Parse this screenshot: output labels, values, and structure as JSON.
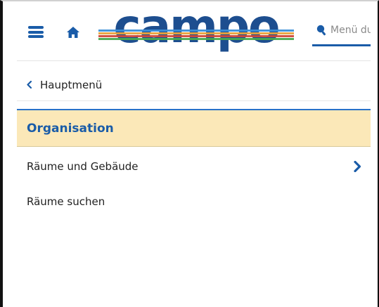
{
  "header": {
    "logo_text": "campo",
    "menu_icon": "hamburger-icon",
    "home_icon": "home-icon",
    "search": {
      "placeholder": "Menü durchsuchen",
      "value": "",
      "icon": "search-icon"
    }
  },
  "navigation": {
    "back_label": "Hauptmenü",
    "back_icon": "chevron-left-icon"
  },
  "section": {
    "title": "Organisation"
  },
  "menu": {
    "items": [
      {
        "label": "Räume und Gebäude",
        "has_submenu": true,
        "icon": "chevron-right-icon"
      },
      {
        "label": "Räume suchen",
        "has_submenu": false
      }
    ]
  },
  "colors": {
    "brand_blue": "#1a5ca8",
    "section_highlight": "#fbe8b8",
    "logo_stripes": [
      "#1d4e8f",
      "#3b8fd8",
      "#e8a33d",
      "#d04a3a",
      "#4aa84f"
    ]
  }
}
